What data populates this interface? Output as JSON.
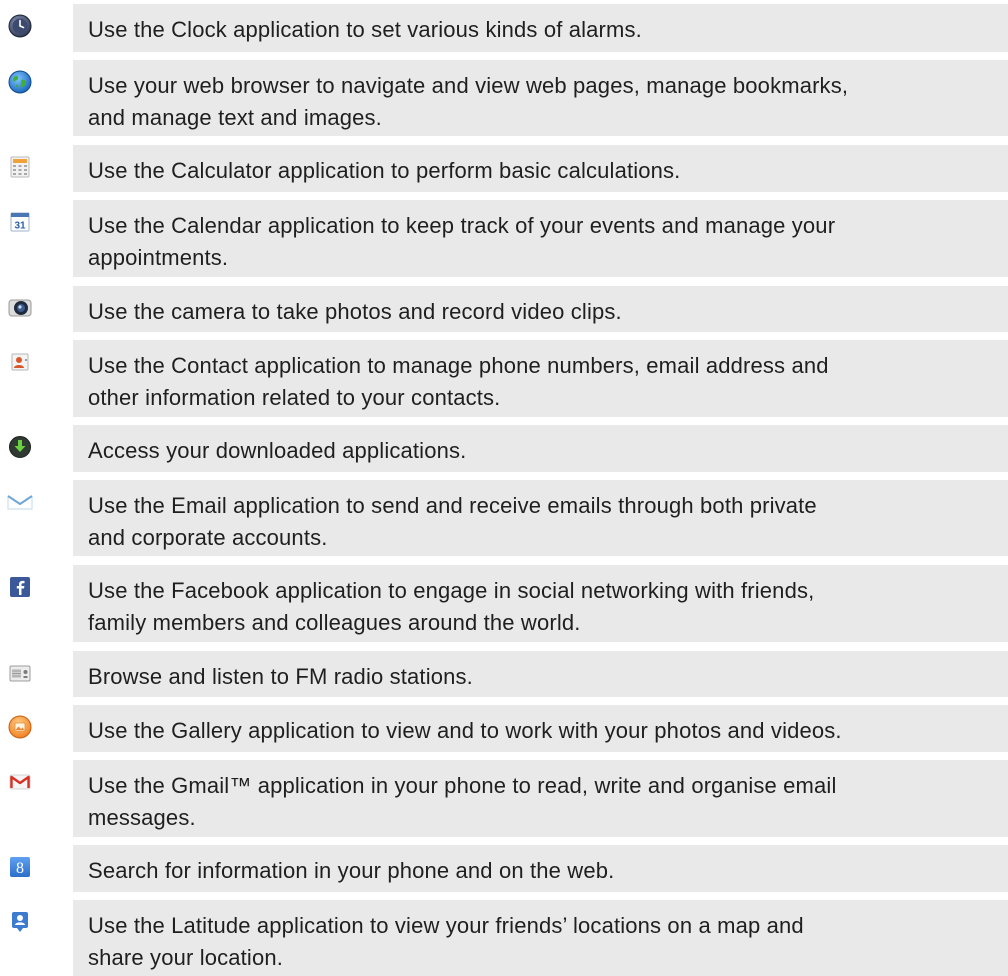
{
  "rows": [
    {
      "icon": "clock-icon",
      "lines": [
        "Use the Clock application to set various kinds of alarms."
      ]
    },
    {
      "icon": "browser-globe-icon",
      "lines": [
        "Use your web browser to navigate and view web pages, manage bookmarks,",
        "and manage text and images."
      ]
    },
    {
      "icon": "calculator-icon",
      "lines": [
        "Use the Calculator application to perform basic calculations."
      ]
    },
    {
      "icon": "calendar-icon",
      "lines": [
        "Use the Calendar application to keep track of your events and manage your",
        "appointments."
      ]
    },
    {
      "icon": "camera-icon",
      "lines": [
        "Use the camera to take photos and record video clips."
      ]
    },
    {
      "icon": "contacts-icon",
      "lines": [
        "Use the Contact application to manage phone numbers, email address and",
        "other information related to your contacts."
      ]
    },
    {
      "icon": "download-icon",
      "lines": [
        "Access your downloaded applications."
      ]
    },
    {
      "icon": "email-icon",
      "lines": [
        "Use the Email application to send and receive emails through both private",
        "and corporate accounts."
      ]
    },
    {
      "icon": "facebook-icon",
      "lines": [
        "Use the Facebook application to engage in social networking with friends,",
        "family members and colleagues around the world."
      ]
    },
    {
      "icon": "fm-radio-icon",
      "lines": [
        "Browse and listen to FM radio stations."
      ]
    },
    {
      "icon": "gallery-icon",
      "lines": [
        "Use the Gallery application to view and to work with your photos and videos."
      ]
    },
    {
      "icon": "gmail-icon",
      "lines": [
        "Use the Gmail™ application in your phone to read, write and organise email",
        "messages."
      ]
    },
    {
      "icon": "google-search-icon",
      "lines": [
        "Search for information in your phone and on the web."
      ]
    },
    {
      "icon": "latitude-icon",
      "lines": [
        "Use the Latitude application to view your friends’ locations on a map and",
        "share your location."
      ]
    }
  ],
  "calendar_icon_day": "31",
  "google_icon_letter": "8"
}
